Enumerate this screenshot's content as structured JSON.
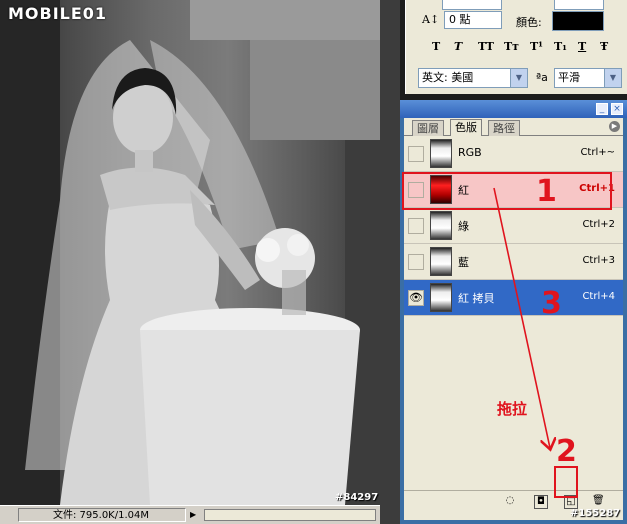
{
  "photo": {
    "logo": "MOBILE01",
    "watermark": "#84297"
  },
  "status_bar": {
    "doc_size": "文件: 795.0K/1.04M"
  },
  "character_panel": {
    "leading_value": "0 點",
    "color_label": "顏色:",
    "color_value": "#000000",
    "style_buttons": [
      "T",
      "T",
      "TT",
      "Tт",
      "T¹",
      "T₁",
      "T",
      "Ŧ"
    ],
    "language": "英文: 美國",
    "aa_label": "ªa",
    "antialias": "平滑"
  },
  "channels_panel": {
    "tabs": [
      {
        "label": "圖層",
        "active": false
      },
      {
        "label": "色版",
        "active": true
      },
      {
        "label": "路徑",
        "active": false
      }
    ],
    "rows": [
      {
        "name": "RGB",
        "shortcut": "Ctrl+~",
        "visible": false,
        "thumb": "gray"
      },
      {
        "name": "紅",
        "shortcut": "Ctrl+1",
        "visible": false,
        "thumb": "red"
      },
      {
        "name": "綠",
        "shortcut": "Ctrl+2",
        "visible": false,
        "thumb": "gray"
      },
      {
        "name": "藍",
        "shortcut": "Ctrl+3",
        "visible": false,
        "thumb": "gray"
      },
      {
        "name": "紅 拷貝",
        "shortcut": "Ctrl+4",
        "visible": true,
        "thumb": "gray"
      }
    ]
  },
  "annotations": {
    "step1": "1",
    "step2": "2",
    "step3": "3",
    "drag_label": "拖拉",
    "accent_color": "#e0141e"
  },
  "watermark_right": "#155287"
}
